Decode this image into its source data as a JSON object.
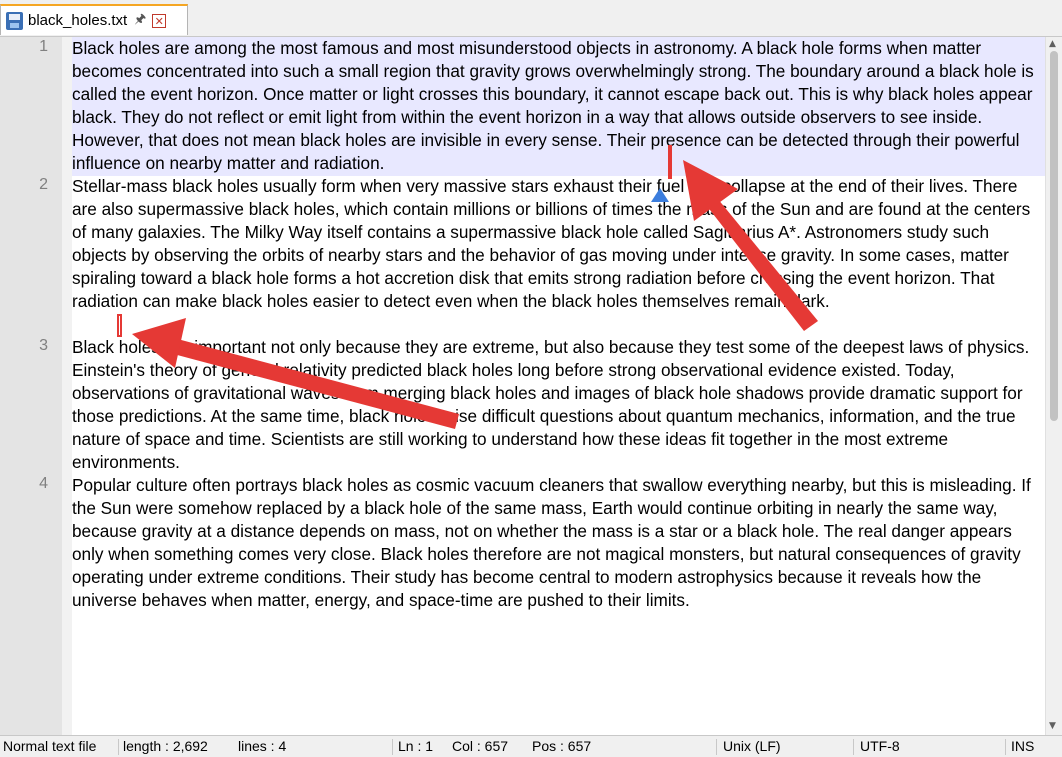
{
  "tab": {
    "title": "black_holes.txt",
    "pin_icon": "pin-icon",
    "close_icon": "close-icon"
  },
  "lines": [
    {
      "number": "1",
      "text": "Black holes are among the most famous and most misunderstood objects in astronomy. A black hole forms when matter becomes concentrated into such a small region that gravity grows overwhelmingly strong. The boundary around a black hole is called the event horizon. Once matter or light crosses this boundary, it cannot escape back out. This is why black holes appear black. They do not reflect or emit light from within the event horizon in a way that allows outside observers to see inside. However, that does not mean black holes are invisible in every sense. Their presence can be detected through their powerful influence on nearby matter and radiation."
    },
    {
      "number": "2",
      "text": "Stellar-mass black holes usually form when very massive stars exhaust their fuel and collapse at the end of their lives. There are also supermassive black holes, which contain millions or billions of times the mass of the Sun and are found at the centers of many galaxies. The Milky Way itself contains a supermassive black hole called Sagittarius A*. Astronomers study such objects by observing the orbits of nearby stars and the behavior of gas moving under intense gravity. In some cases, matter spiraling toward a black hole forms a hot accretion disk that emits strong radiation before crossing the event horizon. That radiation can make black holes easier to detect even when the black holes themselves remain dark."
    },
    {
      "number": "3",
      "text": "Black holes are important not only because they are extreme, but also because they test some of the deepest laws of physics. Einstein's theory of general relativity predicted black holes long before strong observational evidence existed. Today, observations of gravitational waves from merging black holes and images of black hole shadows provide dramatic support for those predictions. At the same time, black holes raise difficult questions about quantum mechanics, information, and the true nature of space and time. Scientists are still working to understand how these ideas fit together in the most extreme environments."
    },
    {
      "number": "4",
      "text": "Popular culture often portrays black holes as cosmic vacuum cleaners that swallow everything nearby, but this is misleading. If the Sun were somehow replaced by a black hole of the same mass, Earth would continue orbiting in nearly the same way, because gravity at a distance depends on mass, not on whether the mass is a star or a black hole. The real danger appears only when something comes very close. Black holes therefore are not magical monsters, but natural consequences of gravity operating under extreme conditions. Their study has become central to modern astrophysics because it reveals how the universe behaves when matter, energy, and space-time are pushed to their limits."
    }
  ],
  "status": {
    "file_type": "Normal text file",
    "length": "length : 2,692",
    "lines": "lines : 4",
    "ln": "Ln : 1",
    "col": "Col : 657",
    "pos": "Pos : 657",
    "eol": "Unix (LF)",
    "encoding": "UTF-8",
    "mode": "INS"
  },
  "colors": {
    "current_line_highlight": "#e8e8ff",
    "annotation_red": "#e53935",
    "marker_blue": "#3b7ddd",
    "gutter": "#e4e4e4"
  }
}
